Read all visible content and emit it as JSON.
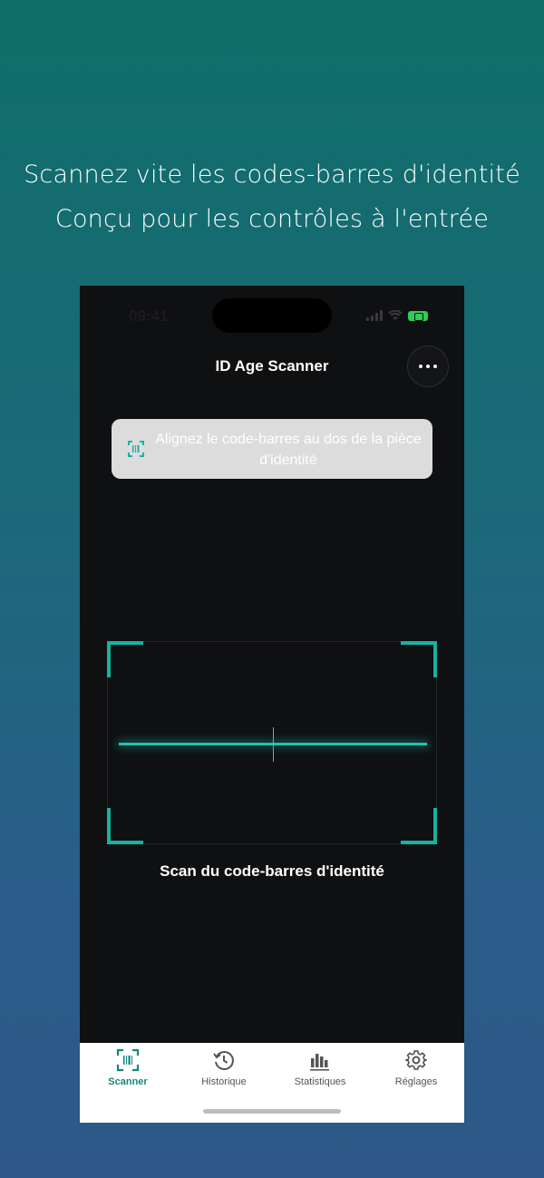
{
  "promo": {
    "line1": "Scannez vite les codes-barres d'identité",
    "line2": "Conçu pour les contrôles à l'entrée"
  },
  "status_bar": {
    "time": "09:41",
    "icons": [
      "signal-icon",
      "wifi-icon",
      "battery-icon"
    ]
  },
  "header": {
    "title": "ID Age Scanner",
    "more_icon": "more-icon"
  },
  "hint": {
    "icon": "barcode-scan-icon",
    "text": "Alignez le code-barres au dos de la pièce d'identité"
  },
  "scanner": {
    "caption": "Scan du code-barres d'identité"
  },
  "tabs": [
    {
      "label": "Scanner",
      "icon": "barcode-scan-icon",
      "active": true
    },
    {
      "label": "Historique",
      "icon": "history-icon",
      "active": false
    },
    {
      "label": "Statistiques",
      "icon": "bar-chart-icon",
      "active": false
    },
    {
      "label": "Réglages",
      "icon": "gear-icon",
      "active": false
    }
  ],
  "colors": {
    "accent": "#16b3a1",
    "tab_active": "#16877d",
    "phone_bg": "#0f1012",
    "background_top": "#0f6e69",
    "background_bottom": "#2d5887"
  }
}
